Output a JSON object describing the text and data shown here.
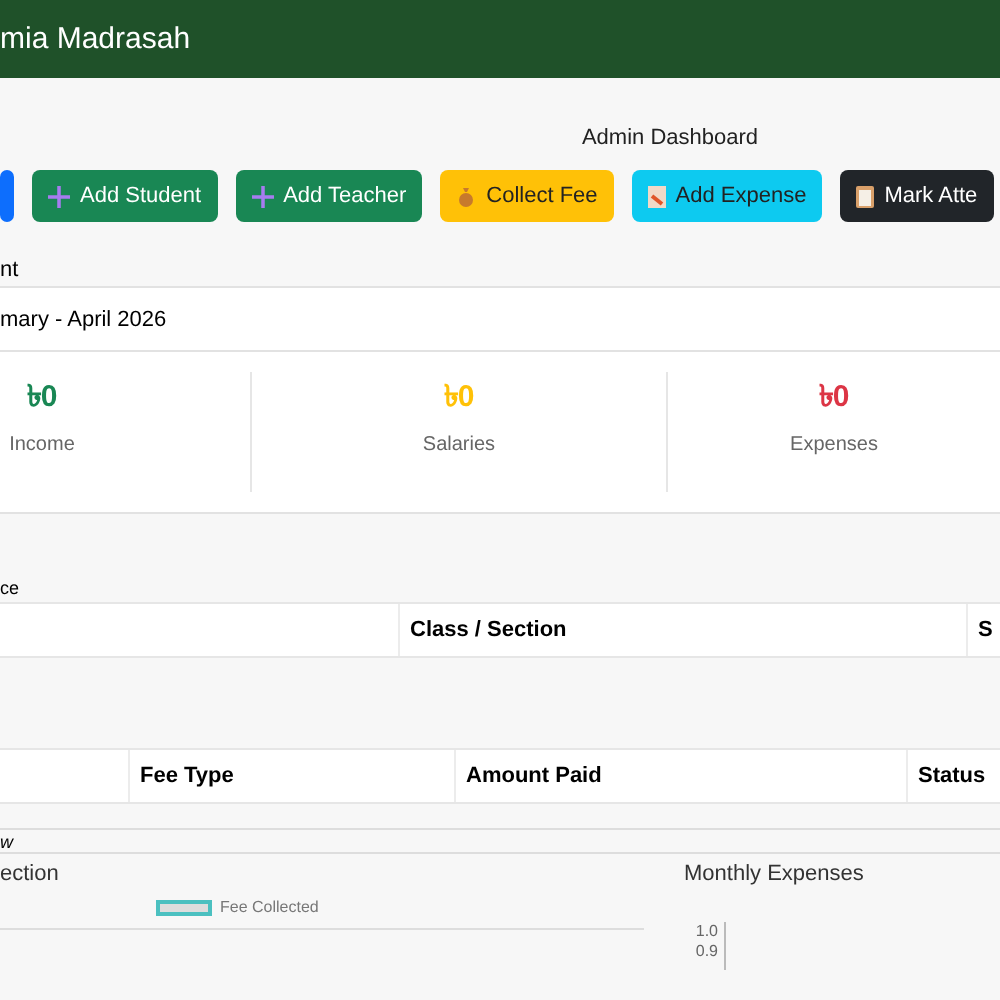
{
  "header": {
    "title": "mia Madrasah"
  },
  "page_title": "Admin Dashboard",
  "actions": [
    {
      "label": "Add Student"
    },
    {
      "label": "Add Teacher"
    },
    {
      "label": "Collect Fee"
    },
    {
      "label": "Add Expense"
    },
    {
      "label": "Mark Atte"
    }
  ],
  "section_label": "nt",
  "summary": {
    "title": "mary - April 2026",
    "stats": [
      {
        "value": "৳0",
        "label": "Income",
        "color": "#198754"
      },
      {
        "value": "৳0",
        "label": "Salaries",
        "color": "#ffc107"
      },
      {
        "value": "৳0",
        "label": "Expenses",
        "color": "#dc3545"
      }
    ]
  },
  "attendance": {
    "title": "ce",
    "columns": [
      "Class / Section",
      "S"
    ]
  },
  "fees": {
    "columns": [
      "Fee Type",
      "Amount Paid",
      "Status"
    ]
  },
  "overview_title": "w",
  "charts": [
    {
      "title": "ection",
      "legend": "Fee Collected"
    },
    {
      "title": "Monthly Expenses",
      "y_ticks": [
        "1.0",
        "0.9"
      ]
    }
  ]
}
